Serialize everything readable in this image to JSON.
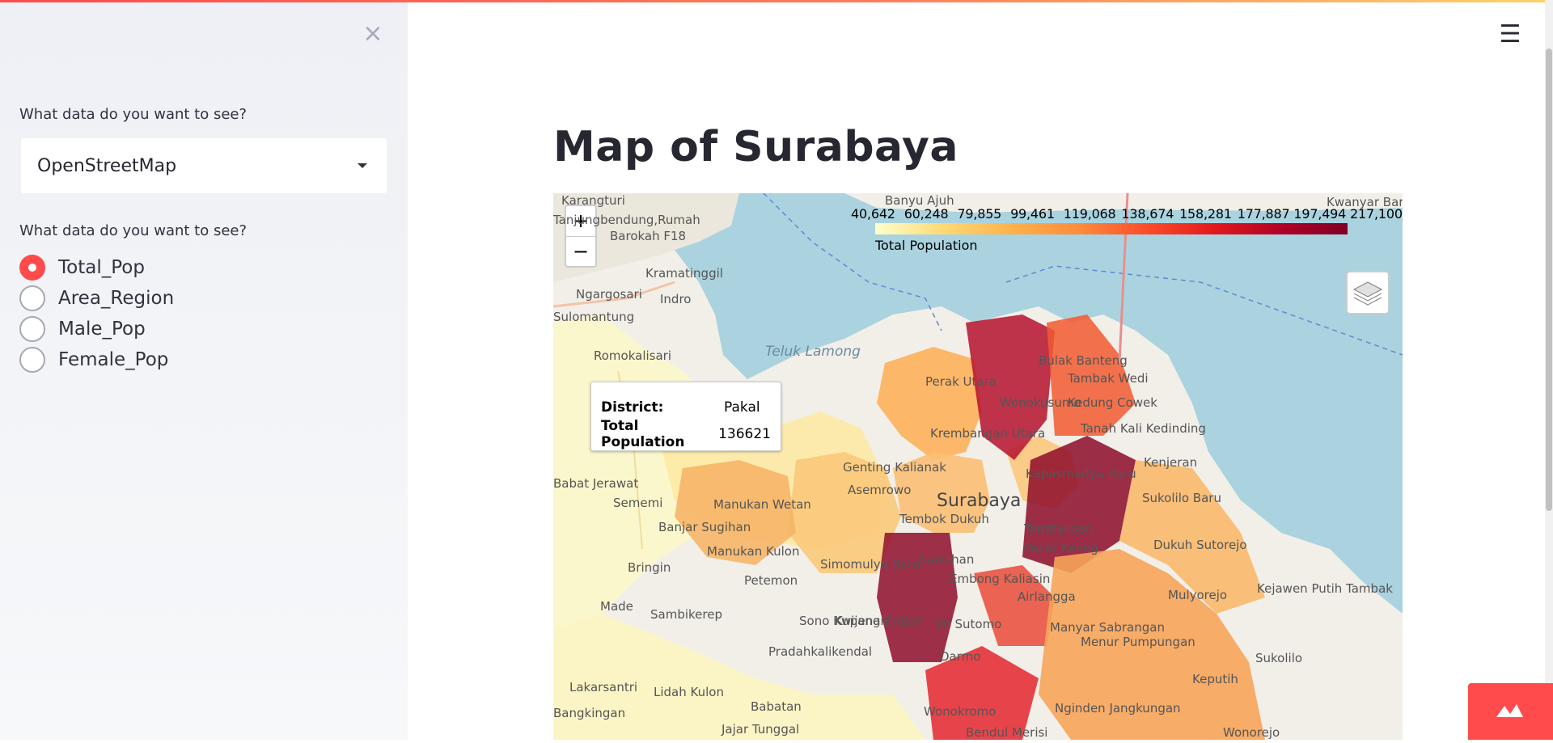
{
  "sidebar": {
    "close_label": "×",
    "select_question": "What data do you want to see?",
    "select_value": "OpenStreetMap",
    "radio_question": "What data do you want to see?",
    "radio_options": [
      "Total_Pop",
      "Area_Region",
      "Male_Pop",
      "Female_Pop"
    ],
    "radio_selected": "Total_Pop"
  },
  "header": {
    "menu_label": "☰"
  },
  "main": {
    "title": "Map of Surabaya"
  },
  "map": {
    "zoom_in": "+",
    "zoom_out": "−",
    "legend": {
      "ticks": [
        "40,642",
        "60,248",
        "79,855",
        "99,461",
        "119,068",
        "138,674",
        "158,281",
        "177,887",
        "197,494",
        "217,100"
      ],
      "caption": "Total Population",
      "colors": [
        "#ffffcc",
        "#fed976",
        "#feb24c",
        "#fd8d3c",
        "#fc4e2a",
        "#e31a1c",
        "#b10026",
        "#800026"
      ]
    },
    "tooltip": {
      "district_key": "District:",
      "district_value": "Pakal",
      "pop_key": "Total Population",
      "pop_value": "136621"
    },
    "place_labels": [
      "Karangturi",
      "Banyu Ajuh",
      "Kwanyar Barat",
      "Tanjungbendung,Rumah",
      "Barokah F18",
      "Kramatinggil",
      "Ngargosari",
      "Indro",
      "Sulomantung",
      "Romokalisari",
      "Teluk Lamong",
      "Perak Utara",
      "Bulak Banteng",
      "Tambak Wedi",
      "Wonokusumo",
      "Kedung Cowek",
      "Tanah Kali Kedinding",
      "Krembangan Utara",
      "Kenjeran",
      "Genting Kalianak",
      "Asemrowo",
      "Kapasmadya Baru",
      "Babat Jerawat",
      "Sememi",
      "Manukan Wetan",
      "Surabaya",
      "Sukolilo Baru",
      "Tembok Dukuh",
      "Tambaksari",
      "Banjar Sugihan",
      "Manukan Kulon",
      "Pacar Keling",
      "Dukuh Sutorejo",
      "Bringin",
      "Simomulyo Baru",
      "Sawahan",
      "Petemon",
      "Kupang Krajan",
      "Embong Kaliasin",
      "Airlangga",
      "Mulyorejo",
      "Kejawen Putih Tambak",
      "Made",
      "Sambikerep",
      "Dr Sutomo",
      "Manyar Sabrangan",
      "Sono Kwijenan",
      "Menur Pumpungan",
      "Pradahkalikendal",
      "Darmo",
      "Sukolilo",
      "Lakarsantri",
      "Lidah Kulon",
      "Keputih",
      "Bangkingan",
      "Babatan",
      "Wonokromo",
      "Nginden Jangkungan",
      "Jajar Tunggal",
      "Bendul Merisi",
      "Wonorejo"
    ]
  },
  "colors": {
    "accent": "#ff4b4b",
    "water": "#aad3df",
    "land": "#f2efe9"
  }
}
